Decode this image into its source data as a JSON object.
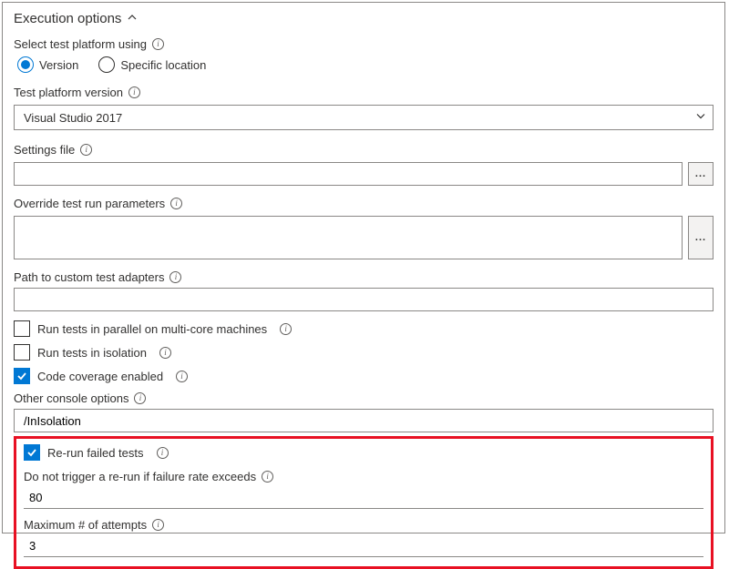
{
  "header": {
    "title": "Execution options"
  },
  "platformSelect": {
    "label": "Select test platform using",
    "options": {
      "version": "Version",
      "specific": "Specific location"
    }
  },
  "platformVersion": {
    "label": "Test platform version",
    "value": "Visual Studio 2017"
  },
  "settingsFile": {
    "label": "Settings file",
    "value": ""
  },
  "overrideParams": {
    "label": "Override test run parameters",
    "value": ""
  },
  "customAdapters": {
    "label": "Path to custom test adapters",
    "value": ""
  },
  "checkboxes": {
    "parallel": "Run tests in parallel on multi-core machines",
    "isolation": "Run tests in isolation",
    "coverage": "Code coverage enabled"
  },
  "otherConsole": {
    "label": "Other console options",
    "value": "/InIsolation"
  },
  "rerun": {
    "checkbox": "Re-run failed tests",
    "failureRateLabel": "Do not trigger a re-run if failure rate exceeds",
    "failureRateValue": "80",
    "maxAttemptsLabel": "Maximum # of attempts",
    "maxAttemptsValue": "3"
  },
  "icons": {
    "moreLabel": "..."
  }
}
